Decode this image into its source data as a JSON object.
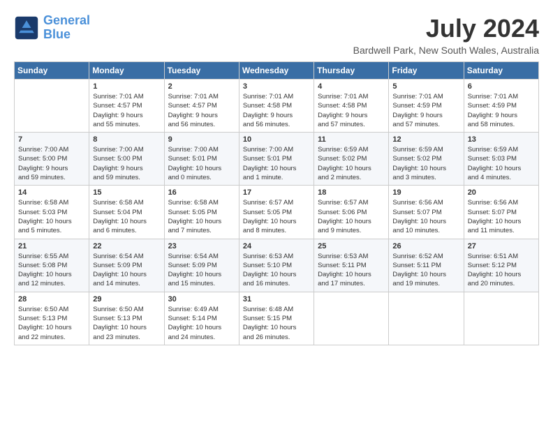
{
  "header": {
    "logo_line1": "General",
    "logo_line2": "Blue",
    "month_title": "July 2024",
    "location": "Bardwell Park, New South Wales, Australia"
  },
  "days_of_week": [
    "Sunday",
    "Monday",
    "Tuesday",
    "Wednesday",
    "Thursday",
    "Friday",
    "Saturday"
  ],
  "weeks": [
    [
      {
        "day": "",
        "info": ""
      },
      {
        "day": "1",
        "info": "Sunrise: 7:01 AM\nSunset: 4:57 PM\nDaylight: 9 hours\nand 55 minutes."
      },
      {
        "day": "2",
        "info": "Sunrise: 7:01 AM\nSunset: 4:57 PM\nDaylight: 9 hours\nand 56 minutes."
      },
      {
        "day": "3",
        "info": "Sunrise: 7:01 AM\nSunset: 4:58 PM\nDaylight: 9 hours\nand 56 minutes."
      },
      {
        "day": "4",
        "info": "Sunrise: 7:01 AM\nSunset: 4:58 PM\nDaylight: 9 hours\nand 57 minutes."
      },
      {
        "day": "5",
        "info": "Sunrise: 7:01 AM\nSunset: 4:59 PM\nDaylight: 9 hours\nand 57 minutes."
      },
      {
        "day": "6",
        "info": "Sunrise: 7:01 AM\nSunset: 4:59 PM\nDaylight: 9 hours\nand 58 minutes."
      }
    ],
    [
      {
        "day": "7",
        "info": "Sunrise: 7:00 AM\nSunset: 5:00 PM\nDaylight: 9 hours\nand 59 minutes."
      },
      {
        "day": "8",
        "info": "Sunrise: 7:00 AM\nSunset: 5:00 PM\nDaylight: 9 hours\nand 59 minutes."
      },
      {
        "day": "9",
        "info": "Sunrise: 7:00 AM\nSunset: 5:01 PM\nDaylight: 10 hours\nand 0 minutes."
      },
      {
        "day": "10",
        "info": "Sunrise: 7:00 AM\nSunset: 5:01 PM\nDaylight: 10 hours\nand 1 minute."
      },
      {
        "day": "11",
        "info": "Sunrise: 6:59 AM\nSunset: 5:02 PM\nDaylight: 10 hours\nand 2 minutes."
      },
      {
        "day": "12",
        "info": "Sunrise: 6:59 AM\nSunset: 5:02 PM\nDaylight: 10 hours\nand 3 minutes."
      },
      {
        "day": "13",
        "info": "Sunrise: 6:59 AM\nSunset: 5:03 PM\nDaylight: 10 hours\nand 4 minutes."
      }
    ],
    [
      {
        "day": "14",
        "info": "Sunrise: 6:58 AM\nSunset: 5:03 PM\nDaylight: 10 hours\nand 5 minutes."
      },
      {
        "day": "15",
        "info": "Sunrise: 6:58 AM\nSunset: 5:04 PM\nDaylight: 10 hours\nand 6 minutes."
      },
      {
        "day": "16",
        "info": "Sunrise: 6:58 AM\nSunset: 5:05 PM\nDaylight: 10 hours\nand 7 minutes."
      },
      {
        "day": "17",
        "info": "Sunrise: 6:57 AM\nSunset: 5:05 PM\nDaylight: 10 hours\nand 8 minutes."
      },
      {
        "day": "18",
        "info": "Sunrise: 6:57 AM\nSunset: 5:06 PM\nDaylight: 10 hours\nand 9 minutes."
      },
      {
        "day": "19",
        "info": "Sunrise: 6:56 AM\nSunset: 5:07 PM\nDaylight: 10 hours\nand 10 minutes."
      },
      {
        "day": "20",
        "info": "Sunrise: 6:56 AM\nSunset: 5:07 PM\nDaylight: 10 hours\nand 11 minutes."
      }
    ],
    [
      {
        "day": "21",
        "info": "Sunrise: 6:55 AM\nSunset: 5:08 PM\nDaylight: 10 hours\nand 12 minutes."
      },
      {
        "day": "22",
        "info": "Sunrise: 6:54 AM\nSunset: 5:09 PM\nDaylight: 10 hours\nand 14 minutes."
      },
      {
        "day": "23",
        "info": "Sunrise: 6:54 AM\nSunset: 5:09 PM\nDaylight: 10 hours\nand 15 minutes."
      },
      {
        "day": "24",
        "info": "Sunrise: 6:53 AM\nSunset: 5:10 PM\nDaylight: 10 hours\nand 16 minutes."
      },
      {
        "day": "25",
        "info": "Sunrise: 6:53 AM\nSunset: 5:11 PM\nDaylight: 10 hours\nand 17 minutes."
      },
      {
        "day": "26",
        "info": "Sunrise: 6:52 AM\nSunset: 5:11 PM\nDaylight: 10 hours\nand 19 minutes."
      },
      {
        "day": "27",
        "info": "Sunrise: 6:51 AM\nSunset: 5:12 PM\nDaylight: 10 hours\nand 20 minutes."
      }
    ],
    [
      {
        "day": "28",
        "info": "Sunrise: 6:50 AM\nSunset: 5:13 PM\nDaylight: 10 hours\nand 22 minutes."
      },
      {
        "day": "29",
        "info": "Sunrise: 6:50 AM\nSunset: 5:13 PM\nDaylight: 10 hours\nand 23 minutes."
      },
      {
        "day": "30",
        "info": "Sunrise: 6:49 AM\nSunset: 5:14 PM\nDaylight: 10 hours\nand 24 minutes."
      },
      {
        "day": "31",
        "info": "Sunrise: 6:48 AM\nSunset: 5:15 PM\nDaylight: 10 hours\nand 26 minutes."
      },
      {
        "day": "",
        "info": ""
      },
      {
        "day": "",
        "info": ""
      },
      {
        "day": "",
        "info": ""
      }
    ]
  ]
}
